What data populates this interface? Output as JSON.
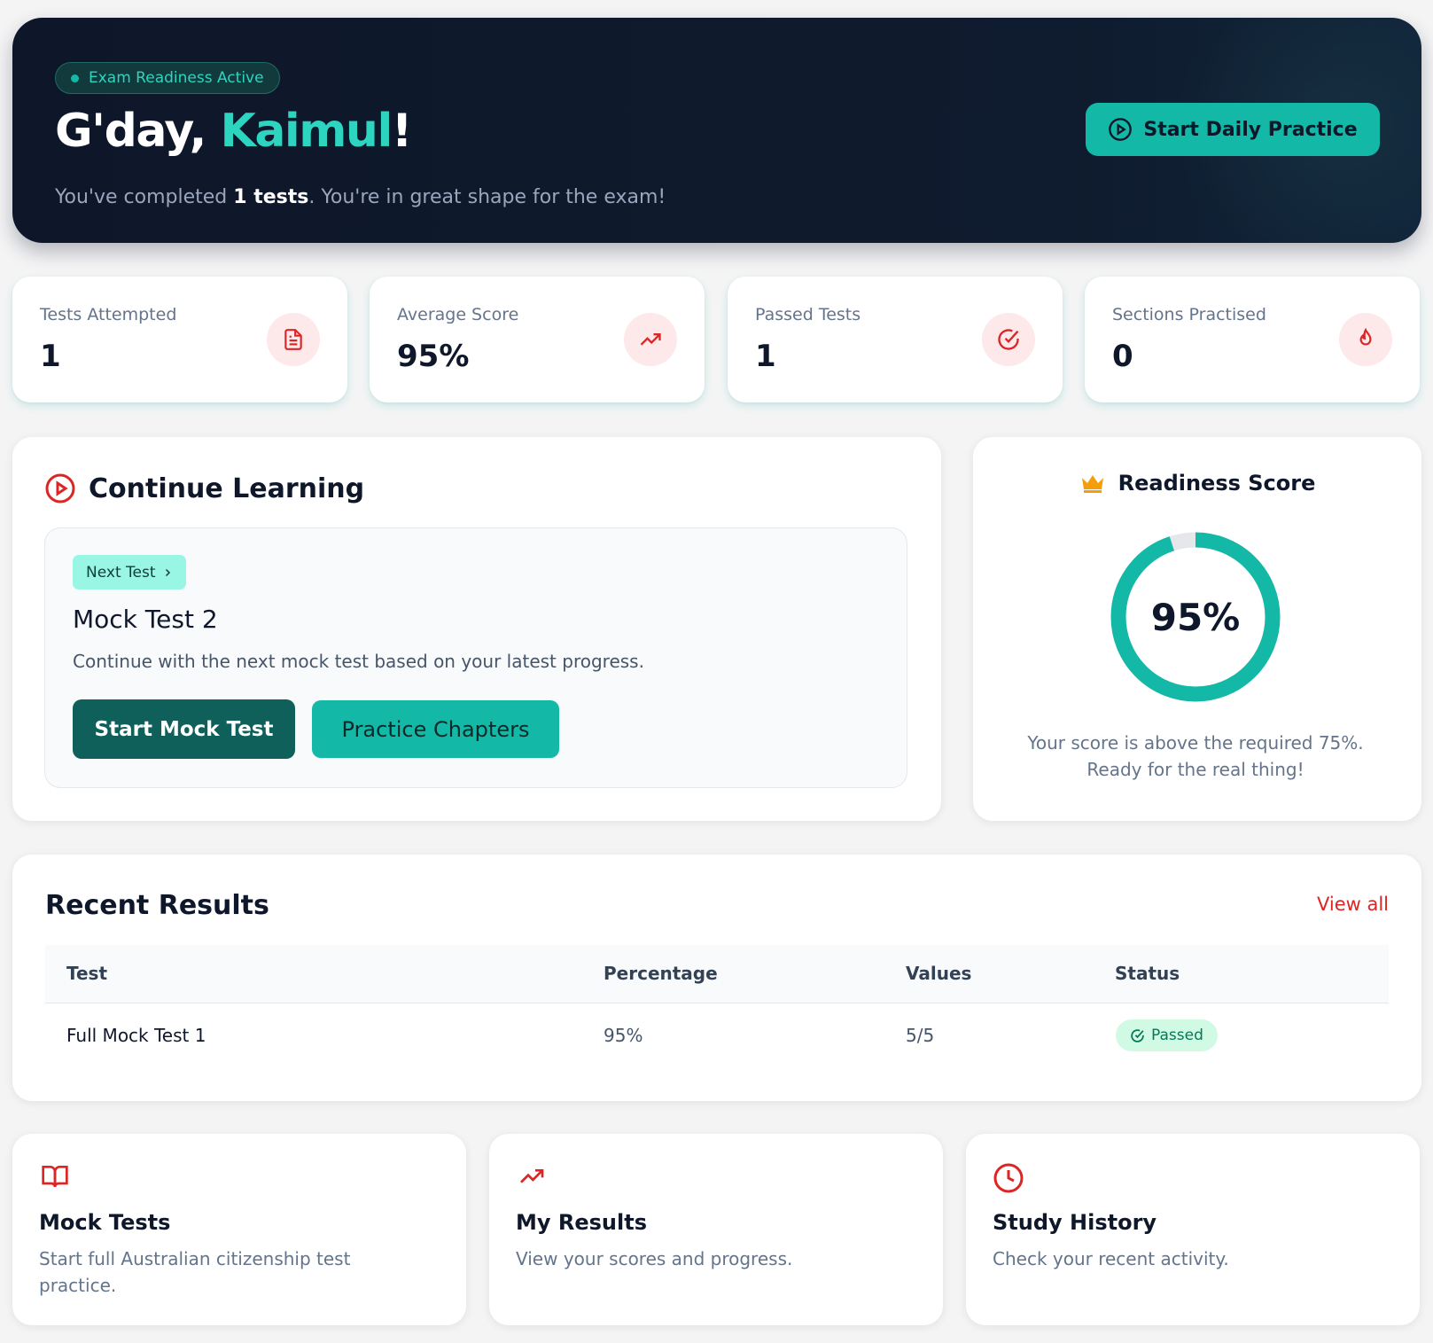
{
  "hero": {
    "badge": "Exam Readiness Active",
    "greeting_prefix": "G'day, ",
    "user_name": "Kaimul",
    "greeting_suffix": "!",
    "sub_prefix": "You've completed ",
    "sub_count": "1 tests",
    "sub_suffix": ". You're in great shape for the exam!",
    "cta_label": "Start Daily Practice"
  },
  "stats": [
    {
      "label": "Tests Attempted",
      "value": "1",
      "icon": "document-icon"
    },
    {
      "label": "Average Score",
      "value": "95%",
      "icon": "trending-up-icon"
    },
    {
      "label": "Passed Tests",
      "value": "1",
      "icon": "check-circle-icon"
    },
    {
      "label": "Sections Practised",
      "value": "0",
      "icon": "flame-icon"
    }
  ],
  "continue_learning": {
    "title": "Continue Learning",
    "tag": "Next Test",
    "test_name": "Mock Test 2",
    "description": "Continue with the next mock test based on your latest progress.",
    "primary_button": "Start Mock Test",
    "secondary_button": "Practice Chapters"
  },
  "readiness": {
    "title": "Readiness Score",
    "score_label": "95%",
    "score_fraction": 0.95,
    "note": "Your score is above the required 75%. Ready for the real thing!"
  },
  "recent_results": {
    "title": "Recent Results",
    "view_all": "View all",
    "columns": [
      "Test",
      "Percentage",
      "Values",
      "Status"
    ],
    "rows": [
      {
        "test": "Full Mock Test 1",
        "percentage": "95%",
        "values": "5/5",
        "status": "Passed"
      }
    ]
  },
  "quick_links": [
    {
      "title": "Mock Tests",
      "description": "Start full Australian citizenship test practice.",
      "icon": "book-open-icon"
    },
    {
      "title": "My Results",
      "description": "View your scores and progress.",
      "icon": "trending-up-icon"
    },
    {
      "title": "Study History",
      "description": "Check your recent activity.",
      "icon": "clock-icon"
    }
  ],
  "colors": {
    "accent": "#14b8a6",
    "hero_bg": "#0e1729",
    "danger": "#dc2626",
    "success_bg": "#d1fae5"
  }
}
